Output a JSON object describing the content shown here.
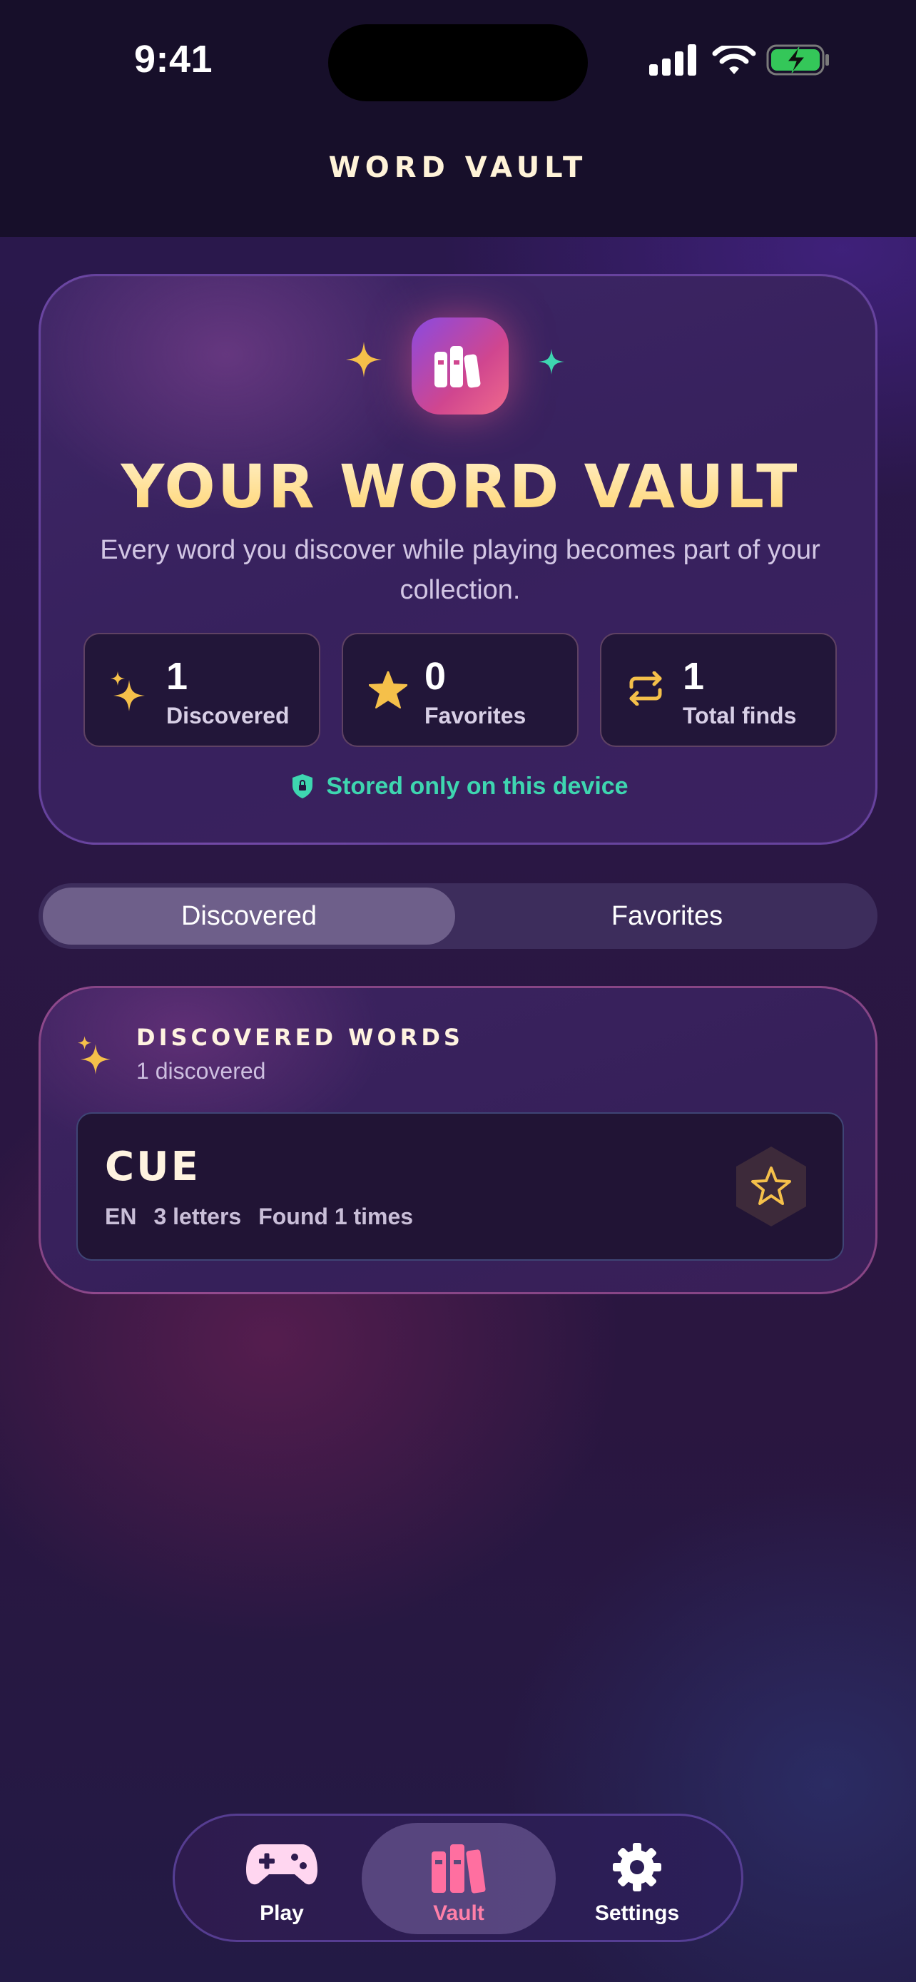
{
  "status_bar": {
    "time": "9:41",
    "icons": [
      "cellular-signal-icon",
      "wifi-icon",
      "battery-charging-icon"
    ]
  },
  "header": {
    "title": "WORD VAULT"
  },
  "hero": {
    "icon": "books-icon",
    "title": "YOUR WORD VAULT",
    "subtitle": "Every word you discover while playing becomes part of your collection.",
    "stats": [
      {
        "value": "1",
        "label": "Discovered",
        "icon": "sparkles-icon"
      },
      {
        "value": "0",
        "label": "Favorites",
        "icon": "star-icon"
      },
      {
        "value": "1",
        "label": "Total finds",
        "icon": "repeat-icon"
      }
    ],
    "storage_note": "Stored only on this device"
  },
  "segmented_control": {
    "options": [
      "Discovered",
      "Favorites"
    ],
    "selected": "Discovered"
  },
  "discovered_words": {
    "title": "DISCOVERED WORDS",
    "count_label": "1 discovered",
    "items": [
      {
        "word": "CUE",
        "language": "EN",
        "length_label": "3 letters",
        "found_label": "Found 1 times",
        "favorite": false
      }
    ]
  },
  "tab_bar": {
    "tabs": [
      {
        "label": "Play",
        "icon": "gamepad-icon"
      },
      {
        "label": "Vault",
        "icon": "books-icon"
      },
      {
        "label": "Settings",
        "icon": "gear-icon"
      }
    ],
    "active": "Vault"
  },
  "colors": {
    "accent_gold": "#ffd36e",
    "accent_teal": "#3ed6b0",
    "accent_pink": "#ff7fa8",
    "background": "#2a1850"
  }
}
